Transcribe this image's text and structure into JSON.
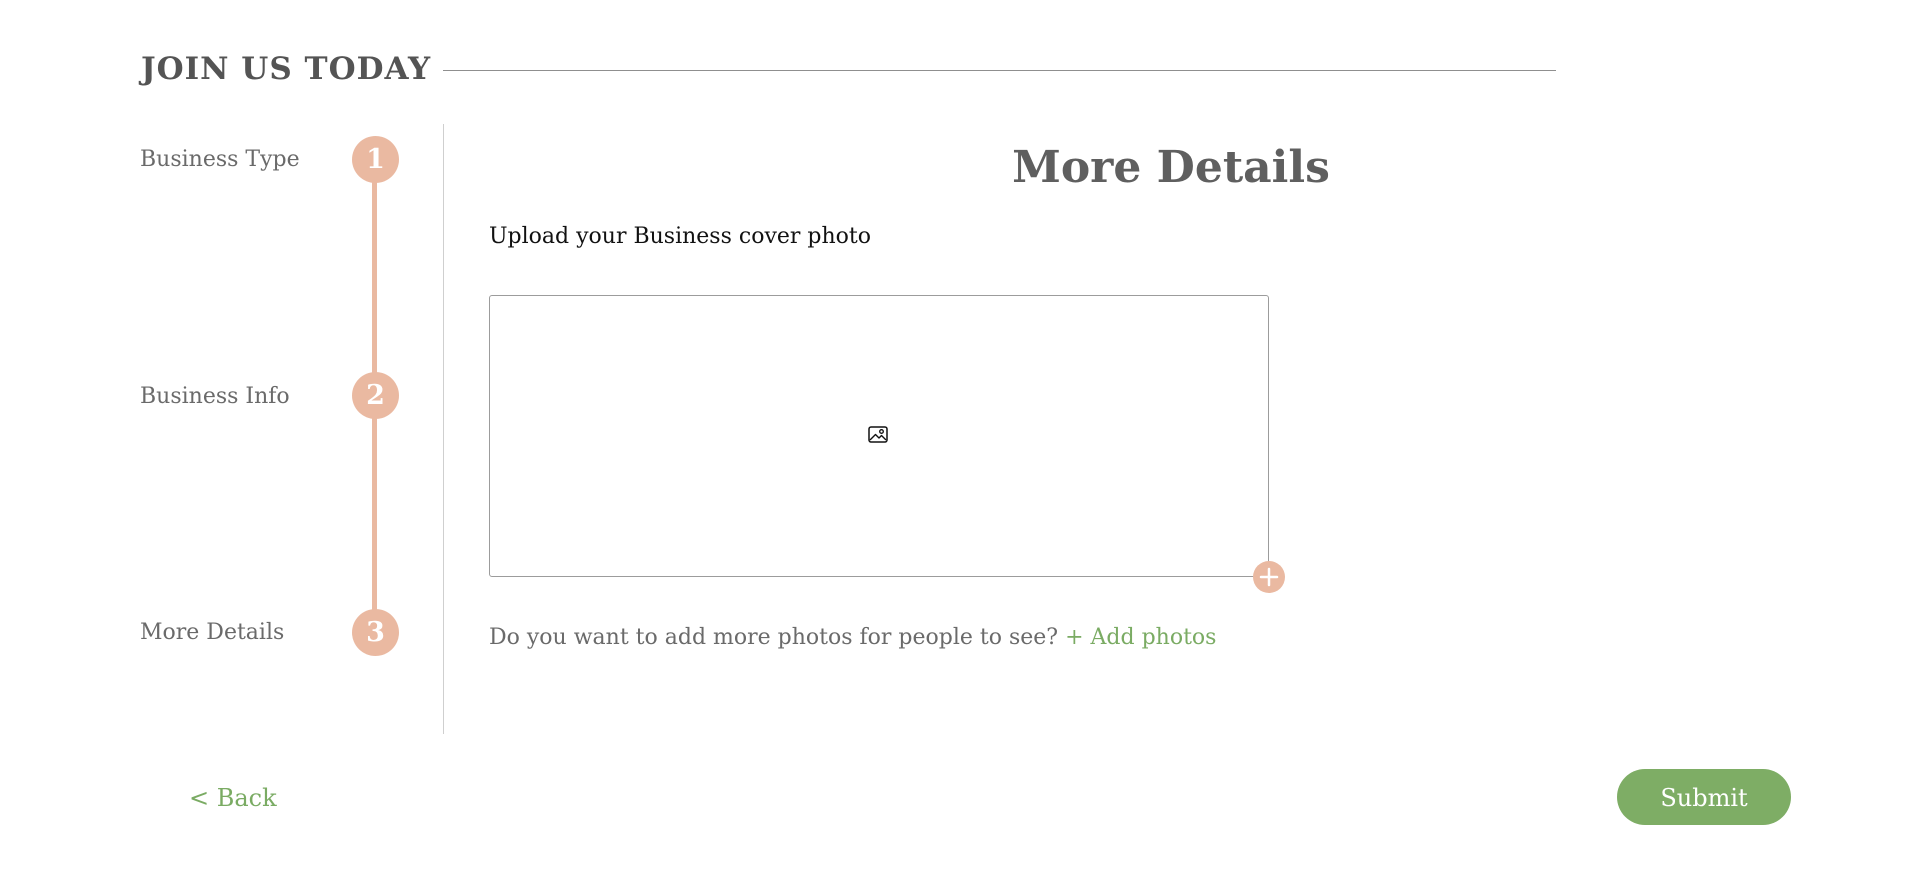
{
  "header": {
    "title": "JOIN US TODAY"
  },
  "stepper": {
    "steps": [
      {
        "number": "1",
        "label": "Business Type"
      },
      {
        "number": "2",
        "label": "Business Info"
      },
      {
        "number": "3",
        "label": "More Details"
      }
    ],
    "accent_color": "#eab9a1"
  },
  "main": {
    "title": "More Details",
    "upload_label": "Upload your Business cover photo",
    "upload_box_icon": "image-icon",
    "add_button_icon": "plus-icon",
    "more_photos_prompt": "Do you want to add more photos for people to see?",
    "add_photos_link": "+ Add photos",
    "link_color": "#7aab63"
  },
  "footer": {
    "back_label": "< Back",
    "submit_label": "Submit",
    "submit_color": "#7ead65"
  }
}
